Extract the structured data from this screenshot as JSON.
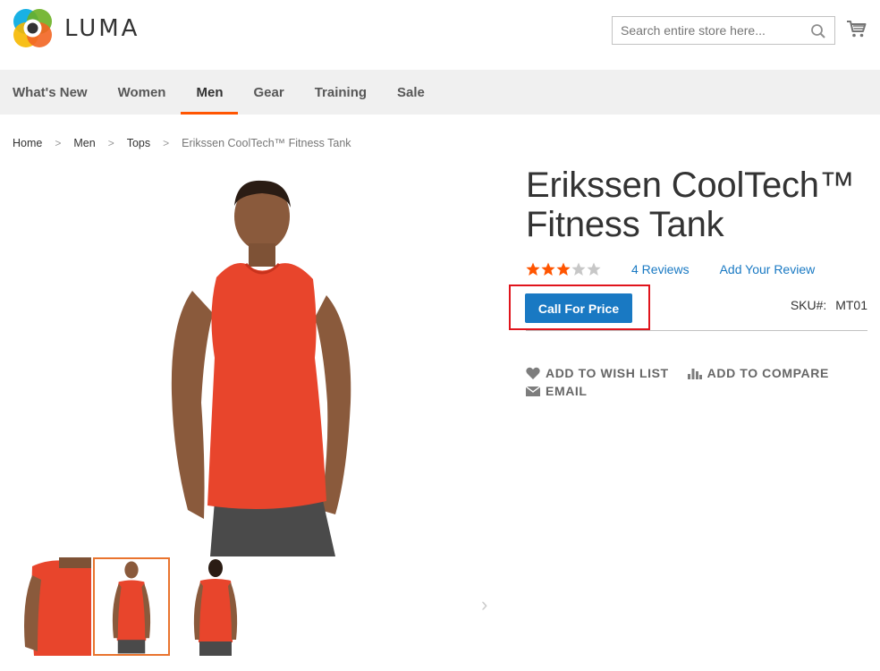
{
  "header": {
    "logo_text": "LUMA",
    "search_placeholder": "Search entire store here...",
    "accent_color": "#ff5501"
  },
  "nav": {
    "items": [
      {
        "label": "What's New",
        "active": false
      },
      {
        "label": "Women",
        "active": false
      },
      {
        "label": "Men",
        "active": true
      },
      {
        "label": "Gear",
        "active": false
      },
      {
        "label": "Training",
        "active": false
      },
      {
        "label": "Sale",
        "active": false
      }
    ]
  },
  "breadcrumbs": {
    "items": [
      "Home",
      "Men",
      "Tops",
      "Erikssen CoolTech™ Fitness Tank"
    ],
    "separator": ">"
  },
  "product": {
    "title_line1": "Erikssen CoolTech™",
    "title_line2": "Fitness Tank",
    "rating": {
      "value": 3,
      "max": 5
    },
    "reviews_label": "4 Reviews",
    "add_review_label": "Add Your Review",
    "call_for_price_label": "Call For Price",
    "sku_label": "SKU#:",
    "sku_value": "MT01",
    "actions": {
      "wish_list": "ADD TO WISH LIST",
      "compare": "ADD TO COMPARE",
      "email": "EMAIL"
    }
  },
  "gallery": {
    "thumbs": [
      "thumb-side",
      "thumb-front",
      "thumb-back"
    ],
    "active_thumb": 1
  },
  "icons": {
    "search": "search-icon",
    "cart": "cart-icon",
    "heart": "heart-icon",
    "compare": "bar-chart-icon",
    "email": "envelope-icon",
    "star": "star-icon"
  },
  "colors": {
    "link": "#1979c3",
    "button": "#1979c3",
    "star_filled": "#ff5501",
    "star_empty": "#c7c7c7",
    "highlight": "#e0141c"
  }
}
